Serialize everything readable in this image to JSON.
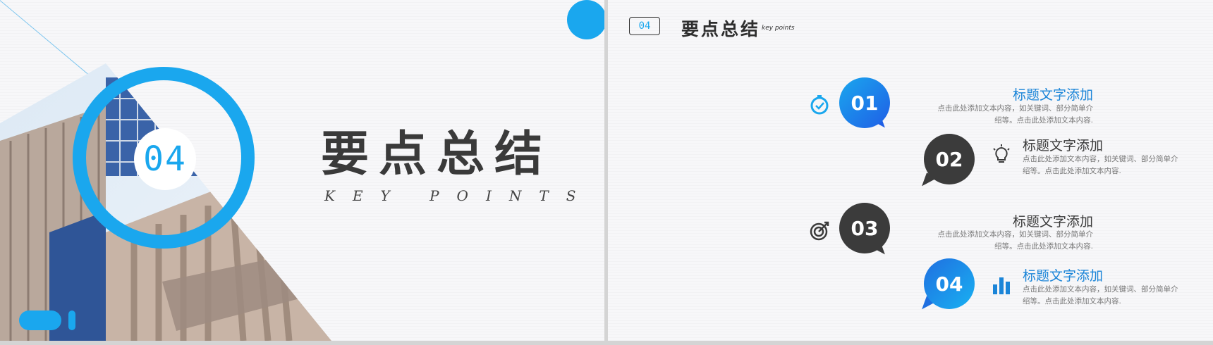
{
  "left_slide": {
    "number": "04",
    "title": "要点总结",
    "subtitle": "KEY POINTS"
  },
  "right_slide": {
    "header": {
      "number": "04",
      "title": "要点总结",
      "subtitle": "key points"
    },
    "items": [
      {
        "num": "01",
        "title": "标题文字添加",
        "desc": "点击此处添加文本内容，如关键词、部分简单介绍等。点击此处添加文本内容.",
        "icon": "stopwatch-icon"
      },
      {
        "num": "02",
        "title": "标题文字添加",
        "desc": "点击此处添加文本内容，如关键词、部分简单介绍等。点击此处添加文本内容.",
        "icon": "lightbulb-icon"
      },
      {
        "num": "03",
        "title": "标题文字添加",
        "desc": "点击此处添加文本内容，如关键词、部分简单介绍等。点击此处添加文本内容.",
        "icon": "target-icon"
      },
      {
        "num": "04",
        "title": "标题文字添加",
        "desc": "点击此处添加文本内容，如关键词、部分简单介绍等。点击此处添加文本内容.",
        "icon": "bar-chart-icon"
      }
    ]
  },
  "colors": {
    "accent": "#1aa7ee",
    "title_blue": "#1b85d8",
    "dark": "#3b3b3b"
  }
}
